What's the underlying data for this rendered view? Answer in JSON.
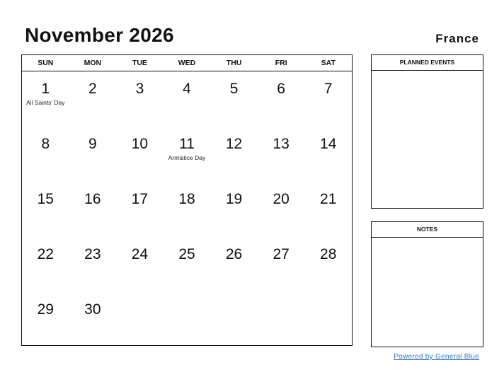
{
  "header": {
    "title": "November 2026",
    "country": "France"
  },
  "calendar": {
    "weekdays": [
      "SUN",
      "MON",
      "TUE",
      "WED",
      "THU",
      "FRI",
      "SAT"
    ],
    "cells": [
      {
        "day": "1",
        "holiday": "All Saints' Day"
      },
      {
        "day": "2"
      },
      {
        "day": "3"
      },
      {
        "day": "4"
      },
      {
        "day": "5"
      },
      {
        "day": "6"
      },
      {
        "day": "7"
      },
      {
        "day": "8"
      },
      {
        "day": "9"
      },
      {
        "day": "10"
      },
      {
        "day": "11",
        "holiday": "Armistice Day"
      },
      {
        "day": "12"
      },
      {
        "day": "13"
      },
      {
        "day": "14"
      },
      {
        "day": "15"
      },
      {
        "day": "16"
      },
      {
        "day": "17"
      },
      {
        "day": "18"
      },
      {
        "day": "19"
      },
      {
        "day": "20"
      },
      {
        "day": "21"
      },
      {
        "day": "22"
      },
      {
        "day": "23"
      },
      {
        "day": "24"
      },
      {
        "day": "25"
      },
      {
        "day": "26"
      },
      {
        "day": "27"
      },
      {
        "day": "28"
      },
      {
        "day": "29"
      },
      {
        "day": "30"
      },
      {
        "day": ""
      },
      {
        "day": ""
      },
      {
        "day": ""
      },
      {
        "day": ""
      },
      {
        "day": ""
      }
    ]
  },
  "panels": {
    "events_label": "PLANNED EVENTS",
    "notes_label": "NOTES"
  },
  "footer": {
    "powered_by": "Powered by General Blue",
    "link_color": "#2e75c4"
  }
}
